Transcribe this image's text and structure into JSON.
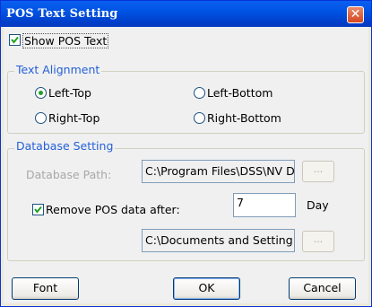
{
  "window": {
    "title": "POS Text Setting",
    "close_glyph": "✕"
  },
  "show_pos_text": {
    "label": "Show POS Text",
    "checked": true
  },
  "text_alignment": {
    "legend": "Text Alignment",
    "options": [
      {
        "label": "Left-Top",
        "selected": true
      },
      {
        "label": "Left-Bottom",
        "selected": false
      },
      {
        "label": "Right-Top",
        "selected": false
      },
      {
        "label": "Right-Bottom",
        "selected": false
      }
    ]
  },
  "database_setting": {
    "legend": "Database Setting",
    "path_label": "Database Path:",
    "path_value": "C:\\Program Files\\DSS\\NV D",
    "browse_label": "...",
    "remove_label": "Remove POS data after:",
    "remove_checked": true,
    "days_value": "7",
    "days_unit": "Day",
    "path2_value": "C:\\Documents and Setting",
    "browse2_label": "..."
  },
  "buttons": {
    "font": "Font",
    "ok": "OK",
    "cancel": "Cancel"
  },
  "colors": {
    "accent": "#2460d8",
    "titlebar": "#0054e3",
    "close": "#d5461f",
    "check": "#21a121"
  }
}
